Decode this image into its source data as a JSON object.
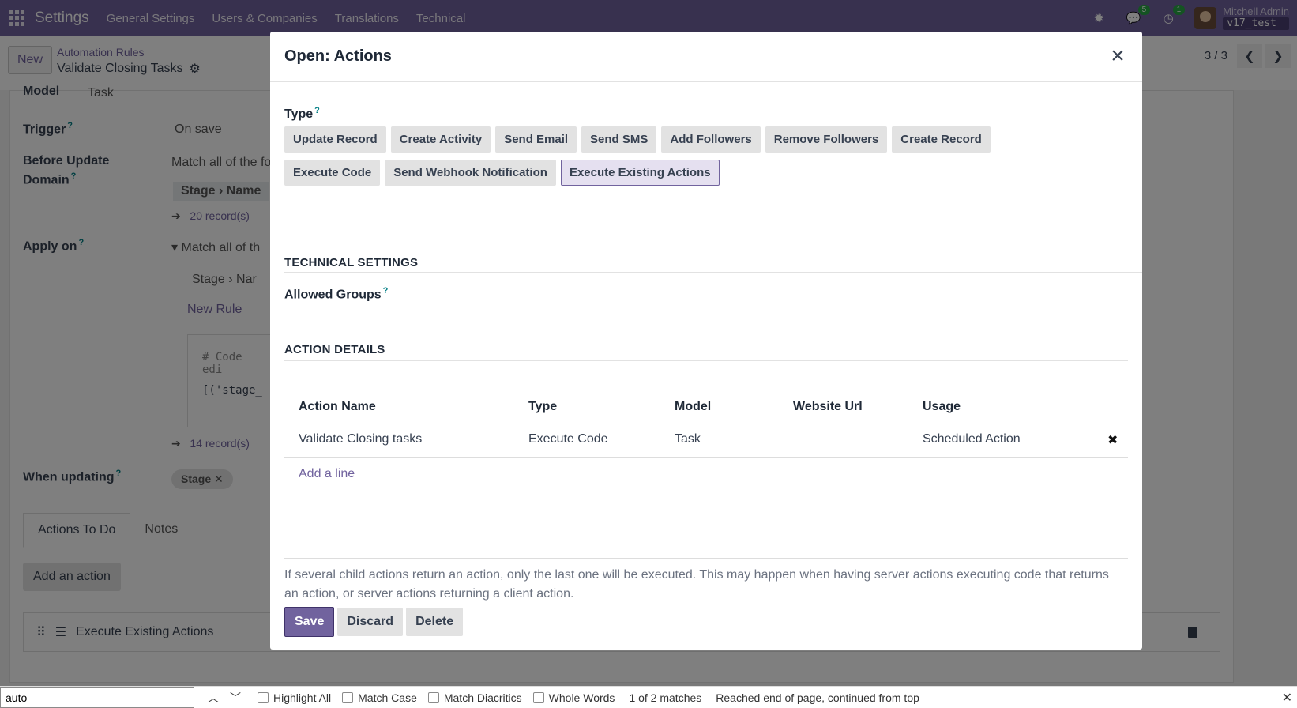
{
  "navbar": {
    "brand": "Settings",
    "menu": [
      "General Settings",
      "Users & Companies",
      "Translations",
      "Technical"
    ],
    "chat_badge": "5",
    "activity_badge": "1",
    "user_name": "Mitchell Admin",
    "database": "v17_test"
  },
  "control_panel": {
    "new_label": "New",
    "breadcrumb": "Automation Rules",
    "record_title": "Validate Closing Tasks",
    "pager": "3 / 3"
  },
  "background_form": {
    "model_label": "Model",
    "model_value": "Task",
    "trigger_label": "Trigger",
    "trigger_value": "On save",
    "before_update_label_1": "Before Update",
    "before_update_label_2": "Domain",
    "before_update_text": "Match all of the fo",
    "before_chip_1": "Stage",
    "before_chip_2": "Name",
    "records_1": "20 record(s)",
    "apply_on_label": "Apply on",
    "apply_on_text": "Match all of th",
    "apply_chip_1": "Stage",
    "apply_chip_2": "Nar",
    "new_rule": "New Rule",
    "code_line_1": "# Code edi",
    "code_line_2": "[('stage_",
    "records_2": "14 record(s)",
    "when_updating_label": "When updating",
    "when_updating_tag": "Stage",
    "tab_actions": "Actions To Do",
    "tab_notes": "Notes",
    "add_action": "Add an action",
    "action_row_label": "Execute Existing Actions"
  },
  "modal": {
    "title": "Open: Actions",
    "type_label": "Type",
    "type_buttons": [
      "Update Record",
      "Create Activity",
      "Send Email",
      "Send SMS",
      "Add Followers",
      "Remove Followers",
      "Create Record",
      "Execute Code",
      "Send Webhook Notification",
      "Execute Existing Actions"
    ],
    "active_type": "Execute Existing Actions",
    "technical_settings": "TECHNICAL SETTINGS",
    "allowed_groups": "Allowed Groups",
    "action_details": "ACTION DETAILS",
    "table": {
      "columns": [
        "Action Name",
        "Type",
        "Model",
        "Website Url",
        "Usage"
      ],
      "rows": [
        [
          "Validate Closing tasks",
          "Execute Code",
          "Task",
          "",
          "Scheduled Action"
        ]
      ],
      "add_line": "Add a line"
    },
    "note": "If several child actions return an action, only the last one will be executed. This may happen when having server actions executing code that returns an action, or server actions returning a client action.",
    "footer": {
      "save": "Save",
      "discard": "Discard",
      "delete": "Delete"
    }
  },
  "findbar": {
    "query": "auto",
    "highlight_all": "Highlight All",
    "match_case": "Match Case",
    "match_diacritics": "Match Diacritics",
    "whole_words": "Whole Words",
    "match_count": "1 of 2 matches",
    "status": "Reached end of page, continued from top"
  }
}
